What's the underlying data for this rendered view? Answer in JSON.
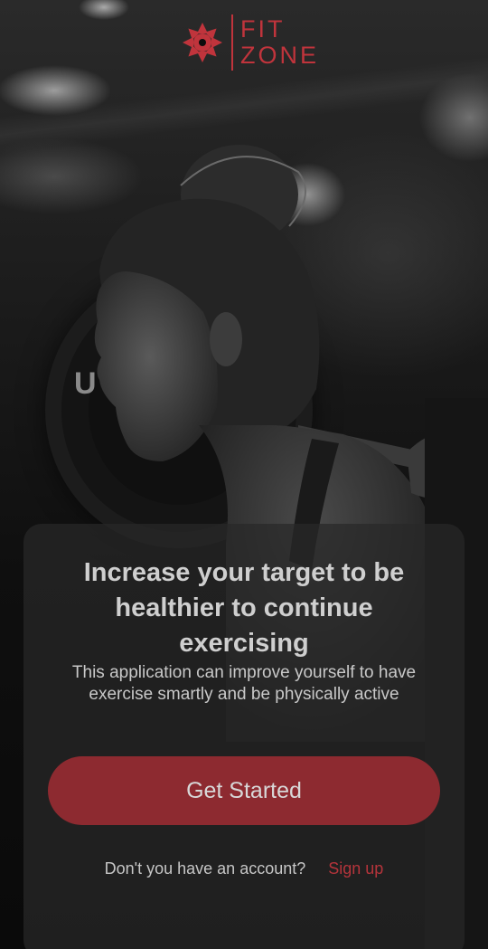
{
  "brand": {
    "line1": "FIT",
    "line2": "ZONE",
    "accent_color": "#c0343c",
    "icon": "lotus-icon"
  },
  "hero": {
    "image_subject": "woman-lifting-barbell-photo"
  },
  "onboarding": {
    "headline": "Increase your target to be healthier to continue exercising",
    "description": "This application can improve yourself to have exercise smartly and be physically active",
    "cta_label": "Get Started",
    "cta_color": "#8d2a30",
    "account_prompt": "Don't you have an account?",
    "signup_label": "Sign up"
  }
}
